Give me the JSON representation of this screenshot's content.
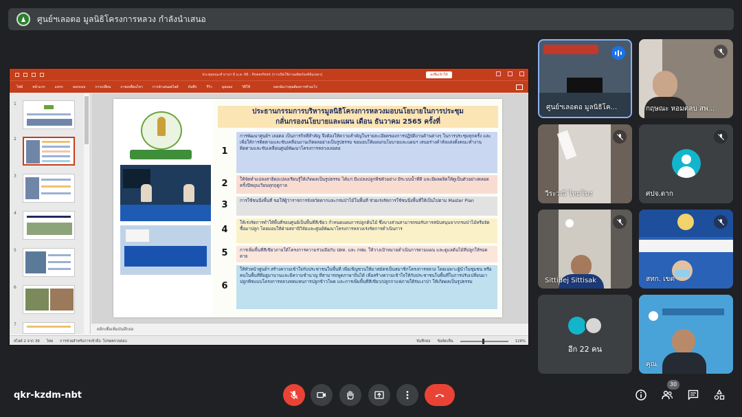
{
  "banner": {
    "presenting_text": "ศูนย์ฯเลอตอ มูลนิธิโครงการหลวง กำลังนำเสนอ"
  },
  "powerpoint": {
    "doc_title": "ประชุมคณะทำงานฯ 6 ม.ค. 66  -  PowerPoint (การเปิดใช้งานผลิตภัณฑ์ล้มเหลว)",
    "warning_label": "ลงชื่อเข้าใช้",
    "ribbon_tabs": [
      "ไฟล์",
      "หน้าแรก",
      "แทรก",
      "ออกแบบ",
      "การเปลี่ยน",
      "ภาพเคลื่อนไหว",
      "การนำเสนอสไลด์",
      "บันทึก",
      "รีวิว",
      "มุมมอง",
      "วิธีใช้"
    ],
    "tell_me": "บอกฉันว่าคุณต้องการทำอะไร",
    "thumbnail_numbers": [
      "1",
      "2",
      "3",
      "4",
      "5",
      "6",
      "7"
    ],
    "notes_placeholder": "คลิกเพื่อเพิ่มบันทึกย่อ",
    "status_slide": "สไลด์ 2 จาก 39",
    "status_lang": "ไทย",
    "status_accessibility": "การช่วยสำหรับการเข้าถึง: โปรดตรวจสอบ",
    "status_notes": "บันทึกย่อ",
    "status_comments": "ข้อคิดเห็น",
    "zoom": "126%"
  },
  "slide": {
    "heading_line1": "ประธานกรรมการบริหารมูลนิธิโครงการหลวงมอบนโยบายในการประชุม",
    "heading_line2": "กลั่นกรองนโยบายและแผน เดือน ธันวาคม  2565  ครั้งที่",
    "items": [
      {
        "num": "1",
        "text": "การพัฒนาศูนย์ฯ เลอตอ เป็นภารกิจที่สำคัญ จึงต้องให้ความสำคัญในรายละเอียดของการปฏิบัติงานด้านต่างๆ ในการประชุมทุกครั้ง และเพื่อให้การติดตามและขับเคลื่อนงานเกิดผลอย่างเป็นรูปธรรม ขอมอบให้แผนกนโยบายและแผนฯ เสนอร่างคำสั่งแต่งตั้งคณะทำงานติดตามและขับเคลื่อนศูนย์พัฒนาโครงการหลวงเลอตอ",
        "color": "#c9d8f0"
      },
      {
        "num": "2",
        "text": "ให้จัดทำแปลงสาธิต/แปลงเรียนรู้ให้เกิดผลเป็นรูปธรรม ได้แก่ มีแปลงปลูกพืชตัวอย่าง มีระบบน้ำที่ดี และมีผลผลิตให้ดูเป็นตัวอย่างตลอดครั้งปีหมุนเวียนทุกฤดูกาล",
        "color": "#f9dcd0"
      },
      {
        "num": "3",
        "text": "การใช้ชนนี่งพื้นที่ ขอให้ผู้ว่าราชการจังหวัดตากและกรมป่าไม้ในพื้นที่ ช่วยเร่งรัดการใช้ชนนี่งพื้นที่ให้เป็นไปตาม Master Plan",
        "color": "#e2e2e2"
      },
      {
        "num": "4",
        "text": "ให้เร่งรัดการทำให้พื้นที่รอบศูนย์เป็นพื้นที่สีเขียว กำหนดแผนการปลูกต้นไม้ ซึ่งบางส่วนสามารถขอรับการสนับสนุนจากกรมป่าไม้หรือจัดซื้อมาปลูก โดยมอบให้ฝ่ายสถานีวิจัยและศูนย์พัฒนาโครงการหลวงเร่งรัดการดำเนินการ",
        "color": "#fbf1c8"
      },
      {
        "num": "5",
        "text": "การเพิ่มพื้นที่สีเขียวภายใต้โครงการความร่วมมือกับ ปตท. และ กฟผ. ให้วางเป้าหมายดำเนินการตามแผน และดูแลต้นไม้ที่ปลูกให้รอดตาย",
        "color": "#fbe6dc"
      },
      {
        "num": "6",
        "text": "ให้หัวหน้าศูนย์ฯ สร้างความเข้าใจกับประชาชนในพื้นที่ เพื่อเชิญชวนให้มาสมัครเป็นสมาชิกโครงการหลวง โดยเฉพาะผู้นำในชุมชน หรือคนในพื้นที่ที่อยู่มานานและมีความชำนาญ ที่สามารถพูดภาษาถิ่นได้ เพื่อสร้างความเข้าใจให้กับประชาชนในพื้นที่ในการปรับเปลี่ยนมาปลูกพืชแบบโครงการหลวงทดแทนการปลูกข้าวโพด และการเพิ่มพื้นที่สีเขียว/ปลูกกาแฟภายใต้ร่มเงาป่า ให้เกิดผลเป็นรูปธรรม",
        "color": "#bfe0ee"
      }
    ]
  },
  "participants": [
    {
      "name": "ศูนย์ฯเลอตอ มูลนิธิโค...",
      "state": "speaking"
    },
    {
      "name": "กฤษณะ หอมตลบ สพ...",
      "state": "muted"
    },
    {
      "name": "วีระวณี ไหมโมง",
      "state": "muted"
    },
    {
      "name": "ศปจ.ตาก",
      "state": "muted"
    },
    {
      "name": "Sittidej Sittisak",
      "state": "muted"
    },
    {
      "name": "สทก. เขต",
      "state": "muted"
    },
    {
      "name": "อีก 22 คน",
      "state": "group"
    },
    {
      "name": "คุณ",
      "state": "muted"
    }
  ],
  "bottom_bar": {
    "meeting_code": "qkr-kzdm-nbt",
    "people_count": "30"
  },
  "colors": {
    "background": "#202124",
    "tile": "#3c4043",
    "ppt_accent": "#c43e1c",
    "end_call": "#ea4335",
    "active_border": "#8ab4f8"
  }
}
